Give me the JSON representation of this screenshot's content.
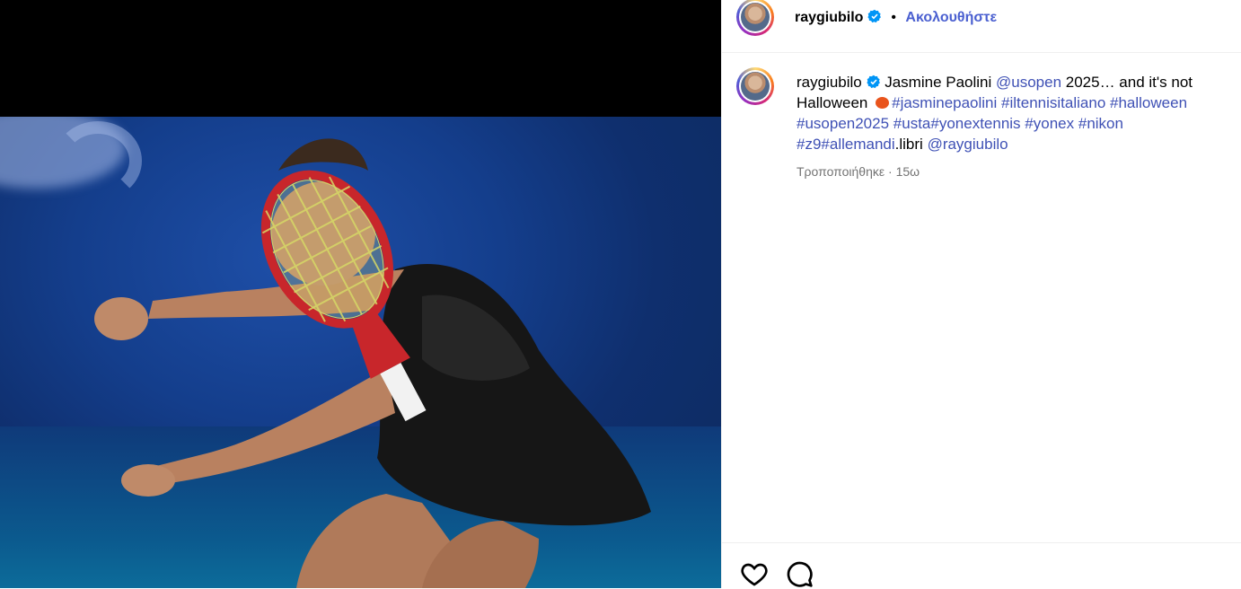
{
  "header": {
    "username": "raygiubilo",
    "separator": "•",
    "follow_label": "Ακολουθήστε"
  },
  "caption": {
    "username": "raygiubilo",
    "segments": [
      {
        "text": " Jasmine Paolini ",
        "tag": false
      },
      {
        "text": "@usopen",
        "tag": true
      },
      {
        "text": " 2025… and it's not Halloween ",
        "tag": false
      },
      {
        "text": "#jasminepaolini",
        "tag": true
      },
      {
        "text": " ",
        "tag": false
      },
      {
        "text": "#iltennisitaliano",
        "tag": true
      },
      {
        "text": " ",
        "tag": false
      },
      {
        "text": "#halloween",
        "tag": true
      },
      {
        "text": " ",
        "tag": false
      },
      {
        "text": "#usopen2025",
        "tag": true
      },
      {
        "text": " ",
        "tag": false
      },
      {
        "text": "#usta",
        "tag": true
      },
      {
        "text": "#yonextennis",
        "tag": true
      },
      {
        "text": " ",
        "tag": false
      },
      {
        "text": "#yonex",
        "tag": true
      },
      {
        "text": " ",
        "tag": false
      },
      {
        "text": "#nikon",
        "tag": true
      },
      {
        "text": " ",
        "tag": false
      },
      {
        "text": "#z9",
        "tag": true
      },
      {
        "text": "#allemandi",
        "tag": true
      },
      {
        "text": ".libri ",
        "tag": false
      },
      {
        "text": "@raygiubilo",
        "tag": true
      }
    ],
    "edited": "Τροποποιήθηκε",
    "meta_separator": "·",
    "time": "15ω"
  },
  "icons": {
    "like": "heart-icon",
    "comment": "comment-icon",
    "verified": "verified-badge-icon",
    "emoji": "pumpkin-emoji"
  },
  "colors": {
    "link": "#3f51b5",
    "follow": "#4a5fd0",
    "verified": "#0095f6"
  }
}
